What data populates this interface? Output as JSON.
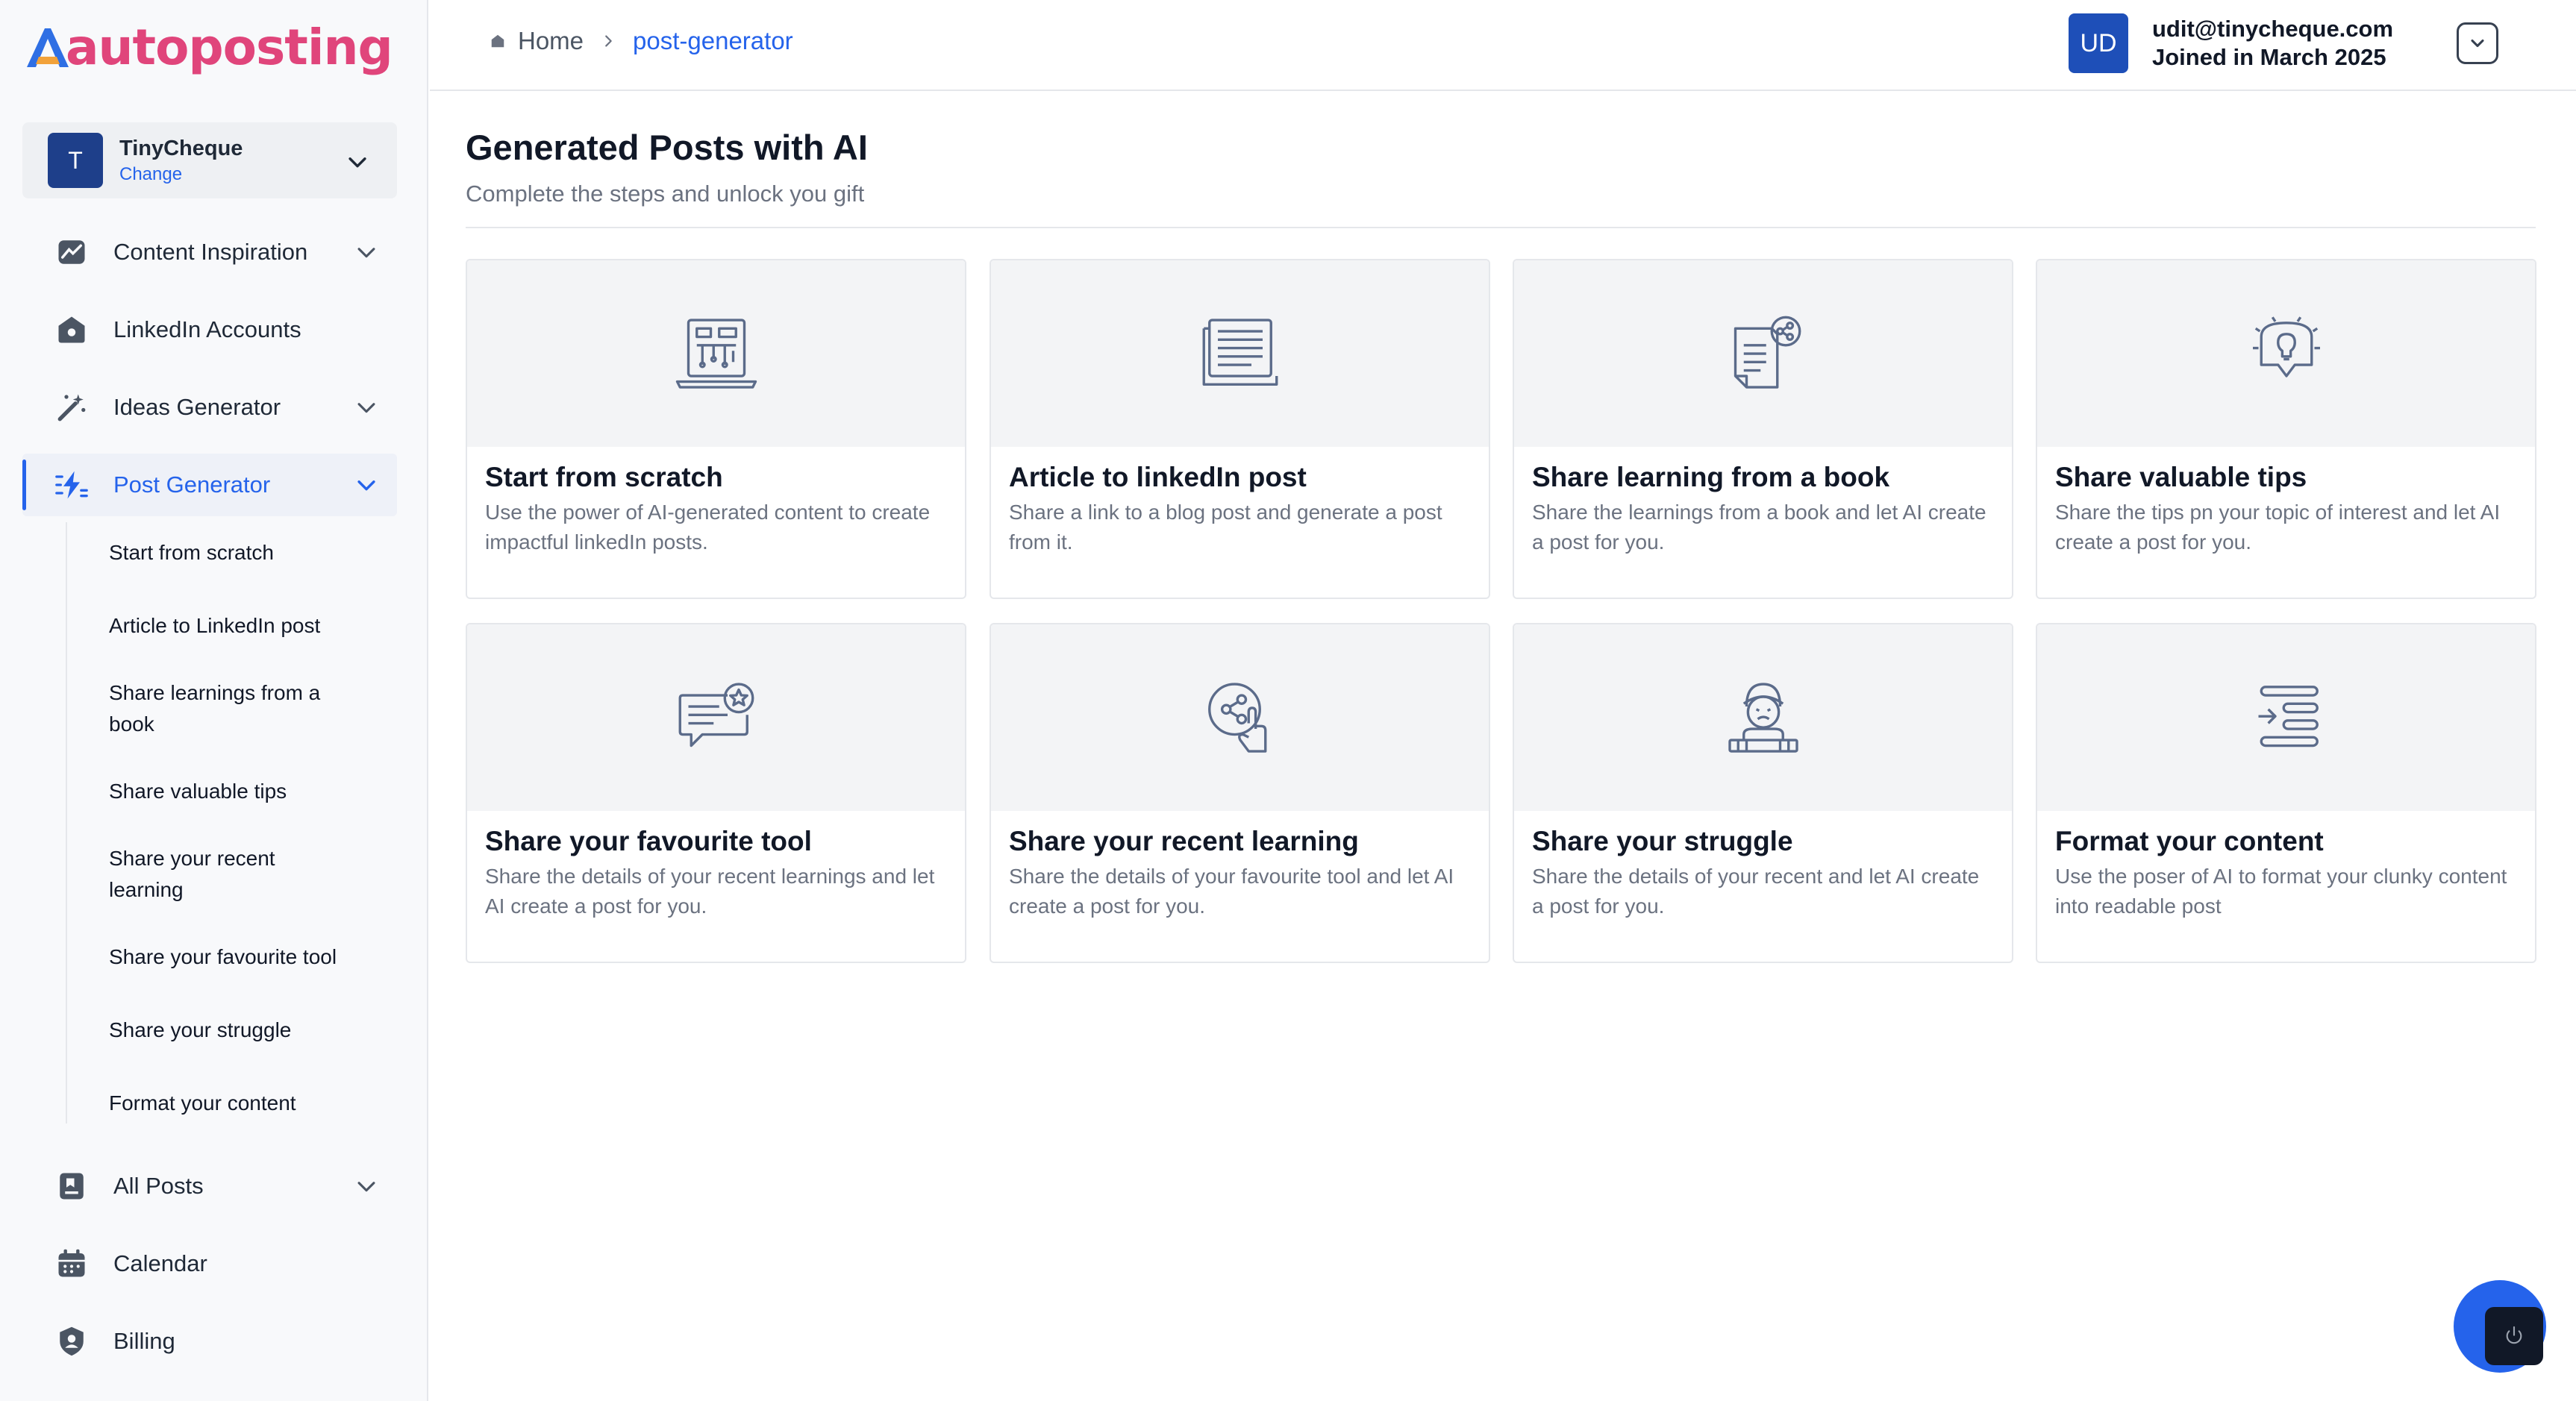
{
  "brand": {
    "name": "autoposting",
    "accent": "#e0457b",
    "primary": "#2563eb"
  },
  "workspace": {
    "initial": "T",
    "name": "TinyCheque",
    "action": "Change"
  },
  "sidebar": {
    "items": [
      {
        "label": "Content Inspiration",
        "icon": "chart-icon",
        "expandable": true
      },
      {
        "label": "LinkedIn Accounts",
        "icon": "house-icon",
        "expandable": false
      },
      {
        "label": "Ideas Generator",
        "icon": "magic-wand-icon",
        "expandable": true
      },
      {
        "label": "Post Generator",
        "icon": "bolt-icon",
        "expandable": true,
        "active": true
      },
      {
        "label": "All Posts",
        "icon": "bookmark-icon",
        "expandable": true
      },
      {
        "label": "Calendar",
        "icon": "calendar-icon",
        "expandable": false
      },
      {
        "label": "Billing",
        "icon": "billing-icon",
        "expandable": false
      }
    ],
    "subitems": [
      "Start from scratch",
      "Article to LinkedIn post",
      "Share learnings from a book",
      "Share valuable tips",
      "Share your recent learning",
      "Share your favourite tool",
      "Share your struggle",
      "Format your content"
    ]
  },
  "breadcrumb": {
    "home": "Home",
    "current": "post-generator"
  },
  "user": {
    "initials": "UD",
    "email": "udit@tinycheque.com",
    "joined": "Joined in March 2025"
  },
  "page": {
    "title": "Generated Posts with AI",
    "subtitle": "Complete the steps and unlock you gift"
  },
  "cards": [
    {
      "title": "Start from scratch",
      "description": "Use the power of AI-generated content to create impactful linkedIn posts.",
      "icon": "laptop-blueprint-icon"
    },
    {
      "title": "Article to linkedIn post",
      "description": "Share a link to a blog post and generate a post from it.",
      "icon": "article-icon"
    },
    {
      "title": "Share learning from a book",
      "description": "Share the learnings from a book and let AI create a post for you.",
      "icon": "book-share-icon"
    },
    {
      "title": "Share valuable tips",
      "description": "Share the tips pn your topic of interest and let AI create a post for you.",
      "icon": "lightbulb-icon"
    },
    {
      "title": "Share your favourite tool",
      "description": "Share the details of your recent learnings and let AI create a post for you.",
      "icon": "chat-star-icon"
    },
    {
      "title": "Share your recent learning",
      "description": "Share the details of your favourite tool and let AI create a post for you.",
      "icon": "share-hand-icon"
    },
    {
      "title": "Share your struggle",
      "description": "Share the details of your recent and let AI create a post for you.",
      "icon": "stressed-person-icon"
    },
    {
      "title": "Format your content",
      "description": "Use the poser of AI to format your clunky content into readable post",
      "icon": "format-lines-icon"
    }
  ]
}
